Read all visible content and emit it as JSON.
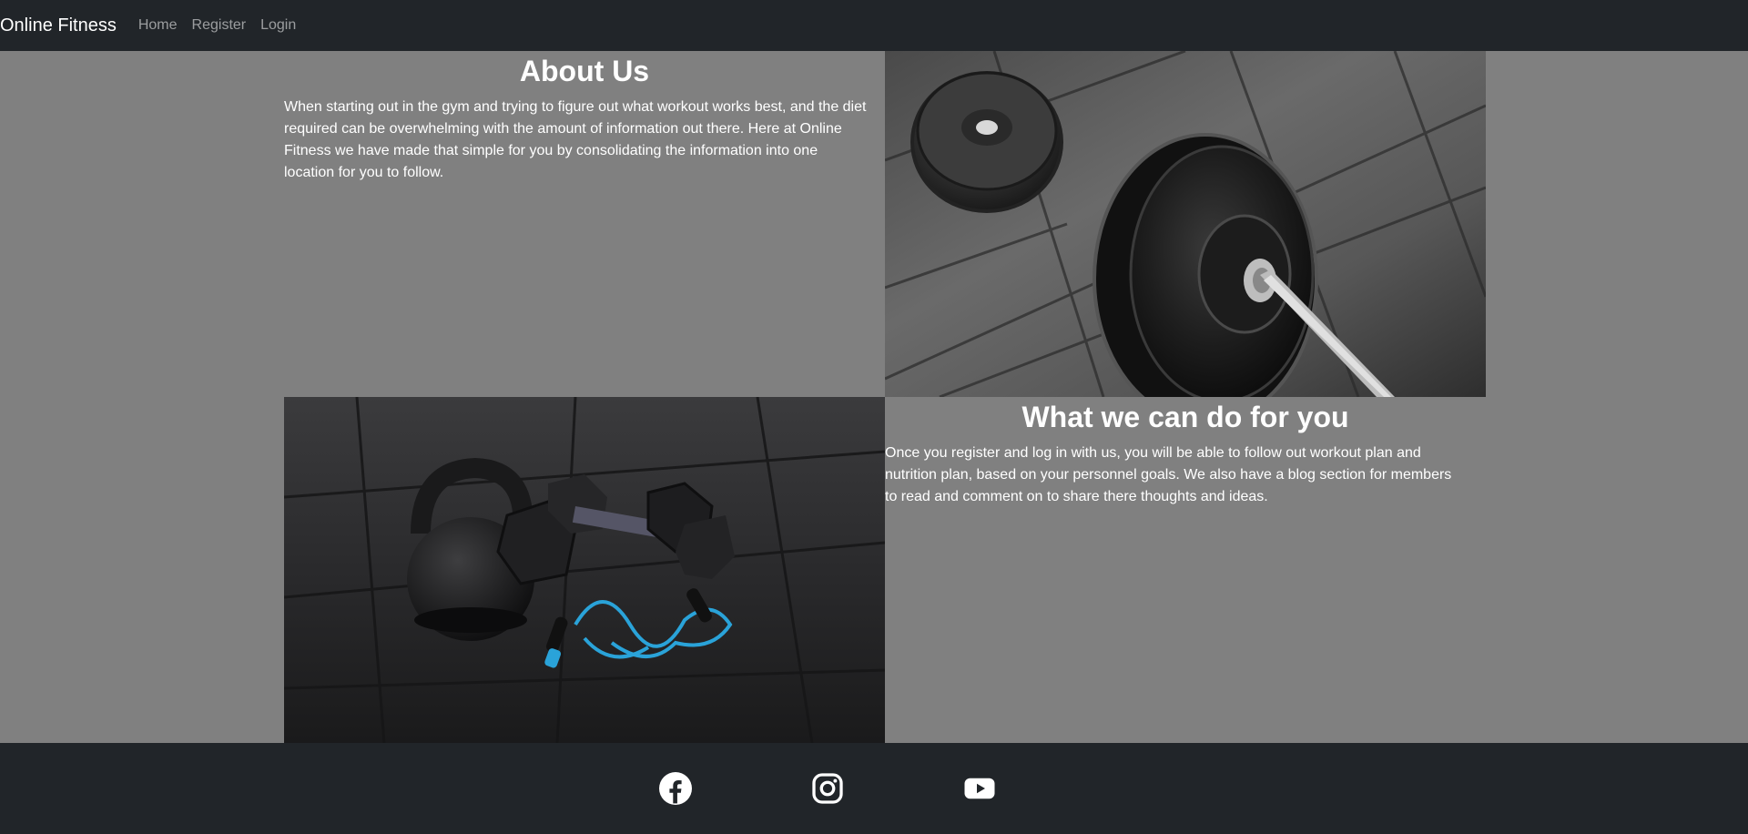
{
  "navbar": {
    "brand": "Online Fitness",
    "links": [
      {
        "label": "Home"
      },
      {
        "label": "Register"
      },
      {
        "label": "Login"
      }
    ]
  },
  "about": {
    "heading": "About Us",
    "text": "When starting out in the gym and trying to figure out what workout works best, and the diet required can be overwhelming with the amount of information out there. Here at Online Fitness we have made that simple for you by consolidating the information into one location for you to follow."
  },
  "services": {
    "heading": "What we can do for you",
    "text": "Once you register and log in with us, you will be able to follow out workout plan and nutrition plan, based on your personnel goals. We also have a blog section for members to read and comment on to share there thoughts and ideas."
  },
  "footer": {
    "social": [
      {
        "icon": "facebook-icon"
      },
      {
        "icon": "instagram-icon"
      },
      {
        "icon": "youtube-icon"
      }
    ]
  },
  "colors": {
    "navbar_bg": "#212529",
    "page_bg": "#808080",
    "footer_bg": "#212529",
    "text": "#ffffff",
    "nav_link": "rgba(255,255,255,0.55)"
  }
}
